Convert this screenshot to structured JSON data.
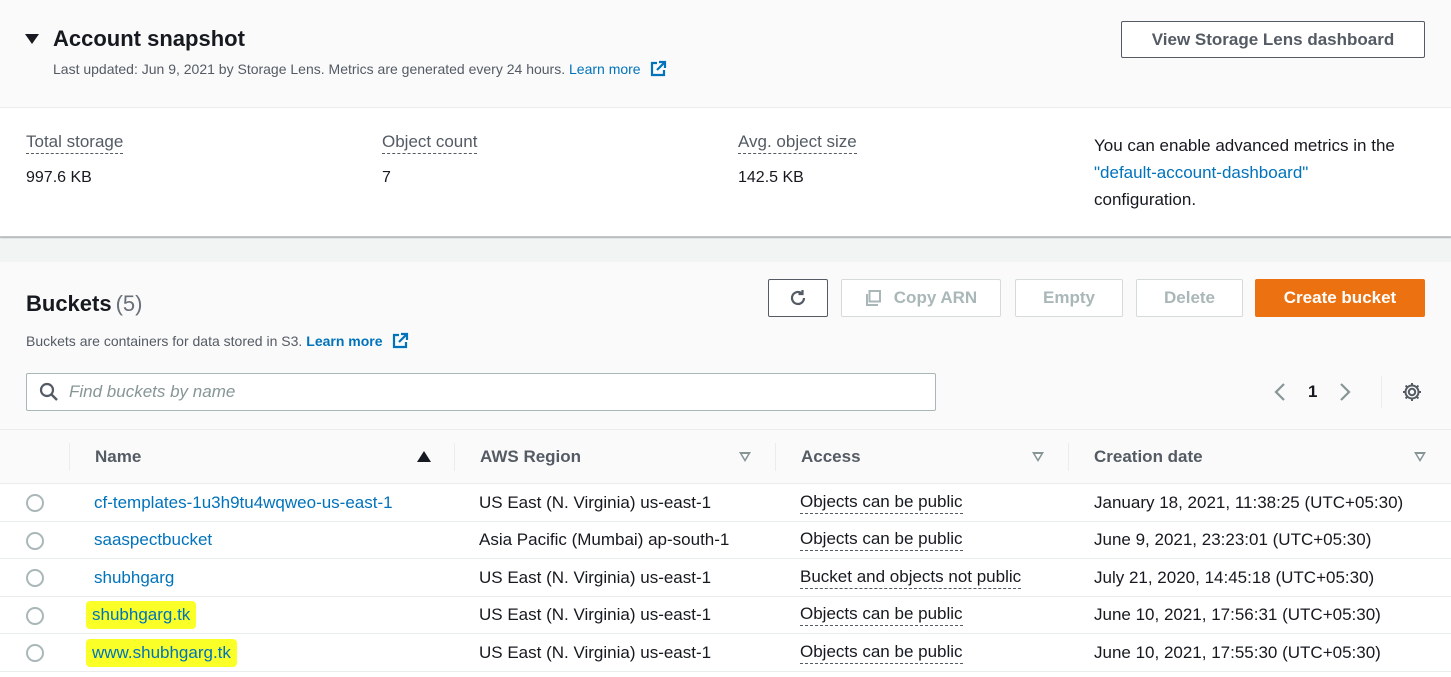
{
  "snapshot": {
    "title": "Account snapshot",
    "subtitle": "Last updated: Jun 9, 2021 by Storage Lens. Metrics are generated every 24 hours.",
    "learn_more": "Learn more",
    "view_button": "View Storage Lens dashboard",
    "metrics": [
      {
        "label": "Total storage",
        "value": "997.6 KB"
      },
      {
        "label": "Object count",
        "value": "7"
      },
      {
        "label": "Avg. object size",
        "value": "142.5 KB"
      }
    ],
    "advanced_note_pre": "You can enable advanced metrics in the",
    "advanced_note_link": "\"default-account-dashboard\"",
    "advanced_note_post": "configuration."
  },
  "buckets": {
    "title": "Buckets",
    "count": "(5)",
    "description": "Buckets are containers for data stored in S3.",
    "learn_more": "Learn more",
    "buttons": {
      "copy_arn": "Copy ARN",
      "empty": "Empty",
      "delete": "Delete",
      "create": "Create bucket"
    },
    "search_placeholder": "Find buckets by name",
    "page": "1",
    "columns": [
      "Name",
      "AWS Region",
      "Access",
      "Creation date"
    ],
    "rows": [
      {
        "name": "cf-templates-1u3h9tu4wqweo-us-east-1",
        "region": "US East (N. Virginia) us-east-1",
        "access": "Objects can be public",
        "created": "January 18, 2021, 11:38:25 (UTC+05:30)",
        "highlighted": false
      },
      {
        "name": "saaspectbucket",
        "region": "Asia Pacific (Mumbai) ap-south-1",
        "access": "Objects can be public",
        "created": "June 9, 2021, 23:23:01 (UTC+05:30)",
        "highlighted": false
      },
      {
        "name": "shubhgarg",
        "region": "US East (N. Virginia) us-east-1",
        "access": "Bucket and objects not public",
        "created": "July 21, 2020, 14:45:18 (UTC+05:30)",
        "highlighted": false
      },
      {
        "name": "shubhgarg.tk",
        "region": "US East (N. Virginia) us-east-1",
        "access": "Objects can be public",
        "created": "June 10, 2021, 17:56:31 (UTC+05:30)",
        "highlighted": true
      },
      {
        "name": "www.shubhgarg.tk",
        "region": "US East (N. Virginia) us-east-1",
        "access": "Objects can be public",
        "created": "June 10, 2021, 17:55:30 (UTC+05:30)",
        "highlighted": true
      }
    ]
  },
  "colors": {
    "link": "#0073bb",
    "primary_button": "#ec7211",
    "highlight": "#faff28"
  }
}
